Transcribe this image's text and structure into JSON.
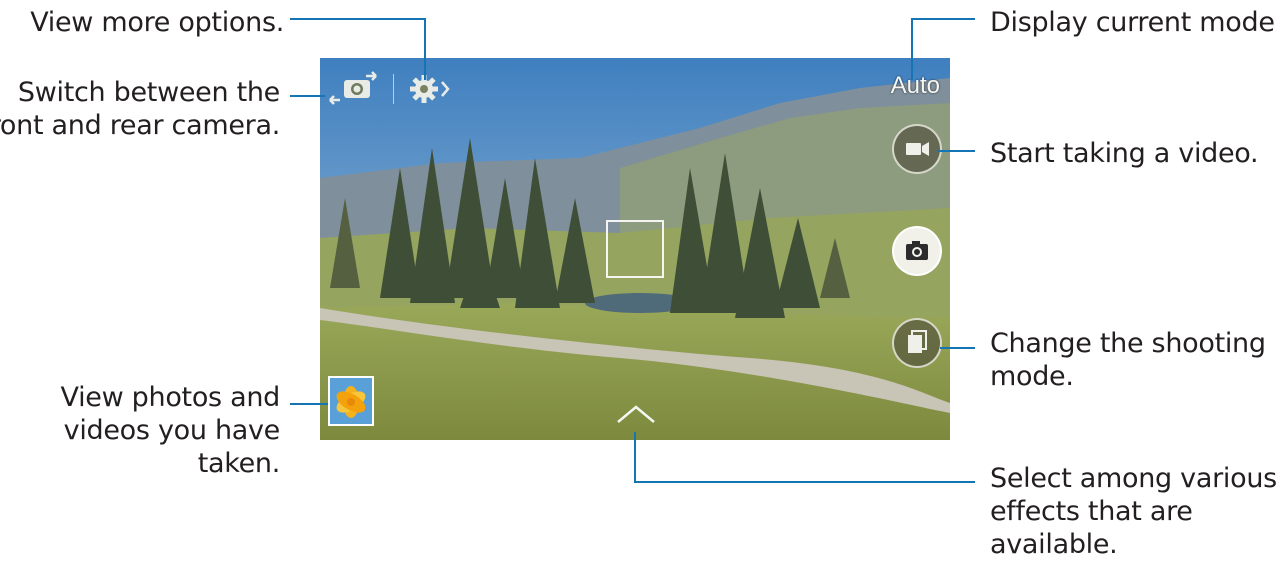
{
  "callouts": {
    "more_options": [
      "View more options."
    ],
    "switch_camera": [
      "Switch between the",
      "front and rear camera."
    ],
    "gallery": [
      "View photos and",
      "videos you have",
      "taken."
    ],
    "current_mode": [
      "Display current mode."
    ],
    "start_video": [
      "Start taking a video."
    ],
    "shooting_mode": [
      "Change the shooting",
      "mode."
    ],
    "effects": [
      "Select among various",
      "effects that are",
      "available."
    ]
  },
  "camera": {
    "mode": "Auto",
    "icons": {
      "switch_camera": "camera-switch-icon",
      "settings": "gear-icon",
      "video": "video-camera-icon",
      "capture": "camera-icon",
      "shooting_mode": "stacked-frames-icon",
      "gallery": "gallery-flower-icon",
      "effects": "chevron-up-icon"
    }
  },
  "colors": {
    "leader_line": "#1474b4",
    "text": "#231f20"
  }
}
